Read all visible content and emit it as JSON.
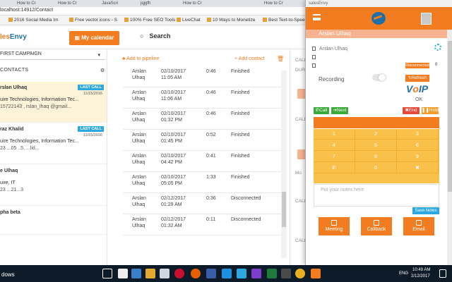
{
  "browser": {
    "tabs": [
      "How to Cr",
      "How to Cr",
      "JavaScri",
      "jqjgfh",
      "How to Cr",
      "How to Cr"
    ],
    "address": "localhost:14912/Contact",
    "bookmarks": [
      "2016 Social Media Im",
      "Free vector icons - S",
      "100% Free SEO Tools",
      "LiveChat",
      "10 Ways to Monetize",
      "Best Text-to-Speech"
    ]
  },
  "app": {
    "logo_a": "les",
    "logo_b": "Envy",
    "calendar_btn": "My calendar",
    "search_label": "Search",
    "campaign": "FIRST CAMPAIGN",
    "contacts_label": "CONTACTS"
  },
  "contacts": [
    {
      "name": "rslan Ulhaq",
      "badge": "LAST CALL",
      "date": "11/15/2016",
      "company": "uire Technologies, Information Tec...",
      "phone": "15722143 , rslan_lhaq @gmail..."
    },
    {
      "name": "raz Khalid",
      "badge": "LAST CALL",
      "date": "11/15/2016",
      "company": "uire Technologies, Information Tec...",
      "phone": "23 ...05 ..5, ...lid..."
    },
    {
      "name": "e Ulhaq",
      "badge": "",
      "date": "",
      "company": "uire, IT",
      "phone": "23 ...21...3"
    },
    {
      "name": "pha beta",
      "badge": "",
      "date": "",
      "company": "",
      "phone": ""
    }
  ],
  "actions": {
    "add_pipeline": "Add to pipeline",
    "add_contact": "+ Add contact"
  },
  "call_rows": [
    {
      "name": [
        "Arslan",
        "Ulhaq"
      ],
      "date": [
        "02/10/2017",
        "11:05 AM"
      ],
      "duration": "0:46",
      "status": "Finished"
    },
    {
      "name": [
        "Arslan",
        "Ulhaq"
      ],
      "date": [
        "02/10/2017",
        "11:06 AM"
      ],
      "duration": "0:46",
      "status": "Finished"
    },
    {
      "name": [
        "Arslan",
        "Ulhaq"
      ],
      "date": [
        "02/10/2017",
        "01:32 PM"
      ],
      "duration": "0:46",
      "status": "Finished"
    },
    {
      "name": [
        "Arslan",
        "Ulhaq"
      ],
      "date": [
        "02/10/2017",
        "01:45 PM"
      ],
      "duration": "0:52",
      "status": "Finished"
    },
    {
      "name": [
        "Arslan",
        "Ulhaq"
      ],
      "date": [
        "02/10/2017",
        "04:42 PM"
      ],
      "duration": "0:41",
      "status": "Finished"
    },
    {
      "name": [
        "Arslan",
        "Ulhaq"
      ],
      "date": [
        "02/10/2017",
        "05:05 PM"
      ],
      "duration": "1:33",
      "status": "Finished"
    },
    {
      "name": [
        "Arslan",
        "Ulhaq"
      ],
      "date": [
        "02/12/2017",
        "01:29 AM"
      ],
      "duration": "0:36",
      "status": "Disconnected"
    },
    {
      "name": [
        "Arslan",
        "Ulhaq"
      ],
      "date": [
        "02/12/2017",
        "01:32 AM"
      ],
      "duration": "0:11",
      "status": "Disconnected"
    }
  ],
  "right_labels": [
    "CALL",
    "DURA",
    "CALL",
    "CALL",
    "Mo",
    "CALL",
    "CALL"
  ],
  "taskbar": {
    "start_text": "dows",
    "time": "10:49 AM",
    "date": "2/12/2017",
    "lang": "ENG"
  },
  "popup": {
    "title": "salesEnvy",
    "contact_name": "Arslan Ulhaq",
    "field_name": "Arslan Ulhaq",
    "status": "Disconnected",
    "status_count": "0",
    "recording": "Recording",
    "refresh": "Refresh",
    "voip_a": "V",
    "voip_b": "o",
    "voip_c": "IP",
    "ok": "OK",
    "call": "Call",
    "next": "Next",
    "end": "End",
    "hold": "Hold",
    "keys": [
      "1",
      "2",
      "3",
      "4",
      "5",
      "6",
      "7",
      "8",
      "9",
      "✆",
      "0",
      "✖"
    ],
    "notes_placeholder": "Put your notes here",
    "save_notes": "Save Notes",
    "meeting": "Meeting",
    "callback": "Callback",
    "email": "Email"
  }
}
